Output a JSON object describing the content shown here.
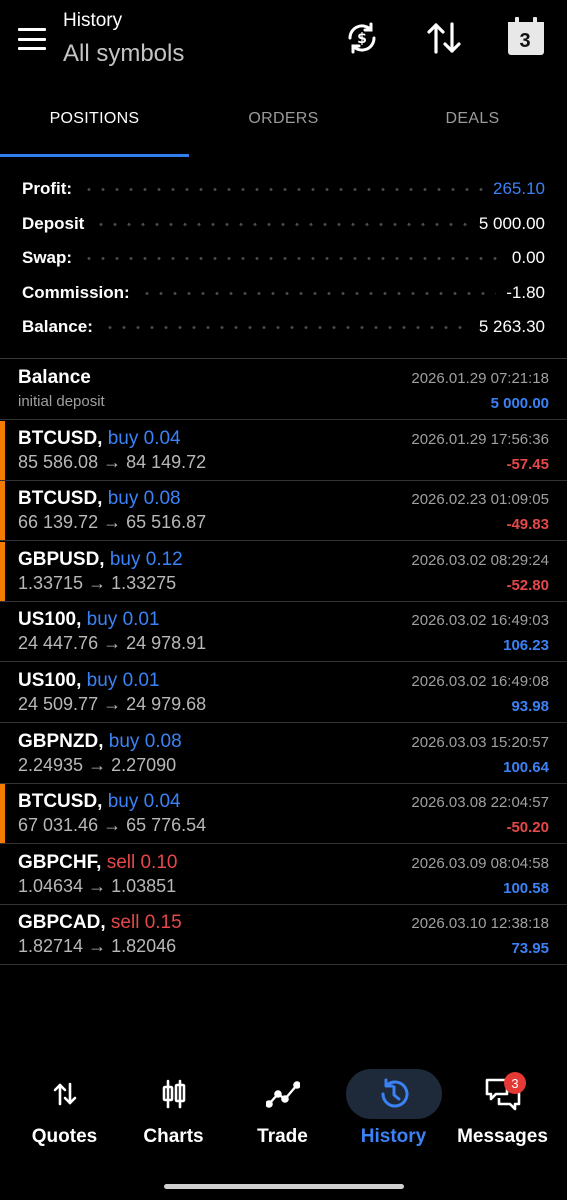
{
  "header": {
    "title": "History",
    "subtitle": "All symbols",
    "calendar_day": "3"
  },
  "tabs": [
    {
      "label": "POSITIONS",
      "active": true
    },
    {
      "label": "ORDERS",
      "active": false
    },
    {
      "label": "DEALS",
      "active": false
    }
  ],
  "summary": {
    "profit_label": "Profit:",
    "profit_value": "265.10",
    "deposit_label": "Deposit",
    "deposit_value": "5 000.00",
    "swap_label": "Swap:",
    "swap_value": "0.00",
    "commission_label": "Commission:",
    "commission_value": "-1.80",
    "balance_label": "Balance:",
    "balance_value": "5 263.30"
  },
  "balance_entry": {
    "title": "Balance",
    "subtitle": "initial deposit",
    "time": "2026.01.29 07:21:18",
    "amount": "5 000.00"
  },
  "positions": [
    {
      "symbol": "BTCUSD,",
      "direction": "buy 0.04",
      "prices": "85 586.08 → 84 149.72",
      "time": "2026.01.29 17:56:36",
      "profit": "-57.45"
    },
    {
      "symbol": "BTCUSD,",
      "direction": "buy 0.08",
      "prices": "66 139.72 → 65 516.87",
      "time": "2026.02.23 01:09:05",
      "profit": "-49.83"
    },
    {
      "symbol": "GBPUSD,",
      "direction": "buy 0.12",
      "prices": "1.33715 → 1.33275",
      "time": "2026.03.02 08:29:24",
      "profit": "-52.80"
    },
    {
      "symbol": "US100,",
      "direction": "buy 0.01",
      "prices": "24 447.76 → 24 978.91",
      "time": "2026.03.02 16:49:03",
      "profit": "106.23"
    },
    {
      "symbol": "US100,",
      "direction": "buy 0.01",
      "prices": "24 509.77 → 24 979.68",
      "time": "2026.03.02 16:49:08",
      "profit": "93.98"
    },
    {
      "symbol": "GBPNZD,",
      "direction": "buy 0.08",
      "prices": "2.24935 → 2.27090",
      "time": "2026.03.03 15:20:57",
      "profit": "100.64"
    },
    {
      "symbol": "BTCUSD,",
      "direction": "buy 0.04",
      "prices": "67 031.46 → 65 776.54",
      "time": "2026.03.08 22:04:57",
      "profit": "-50.20"
    },
    {
      "symbol": "GBPCHF,",
      "direction": "sell 0.10",
      "prices": "1.04634 → 1.03851",
      "time": "2026.03.09 08:04:58",
      "profit": "100.58"
    },
    {
      "symbol": "GBPCAD,",
      "direction": "sell 0.15",
      "prices": "1.82714 → 1.82046",
      "time": "2026.03.10 12:38:18",
      "profit": "73.95"
    }
  ],
  "nav": {
    "quotes": "Quotes",
    "charts": "Charts",
    "trade": "Trade",
    "history": "History",
    "messages": "Messages",
    "messages_badge": "3"
  },
  "colors": {
    "accent": "#3b82f6",
    "loss": "#e54848",
    "marker": "#f57c00"
  }
}
